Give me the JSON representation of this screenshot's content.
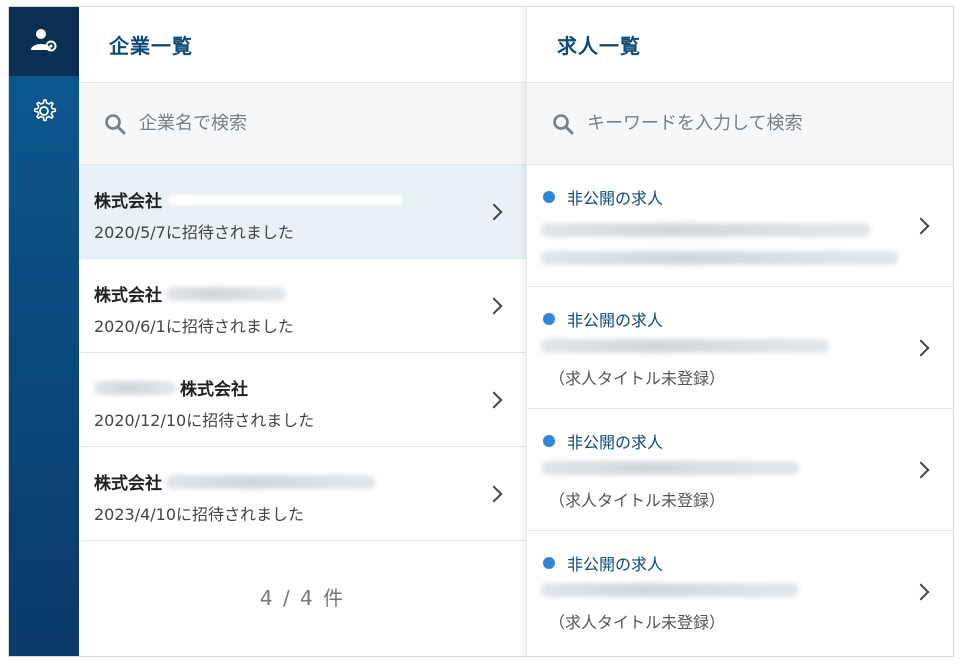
{
  "sidebar": {
    "items": [
      {
        "icon": "user-settings-icon"
      },
      {
        "icon": "gear-icon"
      }
    ]
  },
  "companies": {
    "title": "企業一覧",
    "search_placeholder": "企業名で検索",
    "items": [
      {
        "name": "株式会社",
        "invited": "2020/5/7に招待されました",
        "selected": true
      },
      {
        "name": "株式会社",
        "invited": "2020/6/1に招待されました",
        "selected": false
      },
      {
        "name": "株式会社",
        "invited": "2020/12/10に招待されました",
        "selected": false
      },
      {
        "name": "株式会社",
        "invited": "2023/4/10に招待されました",
        "selected": false
      }
    ],
    "count": "4 / 4 件"
  },
  "jobs": {
    "title": "求人一覧",
    "search_placeholder": "キーワードを入力して検索",
    "items": [
      {
        "status": "非公開の求人",
        "untitled": ""
      },
      {
        "status": "非公開の求人",
        "untitled": "（求人タイトル未登録）"
      },
      {
        "status": "非公開の求人",
        "untitled": "（求人タイトル未登録）"
      },
      {
        "status": "非公開の求人",
        "untitled": "（求人タイトル未登録）"
      }
    ]
  },
  "colors": {
    "accent": "#0e4a7a",
    "status_dot": "#2f86d7",
    "rail": "#0b4b80",
    "selected_row": "#e8f1f5"
  }
}
